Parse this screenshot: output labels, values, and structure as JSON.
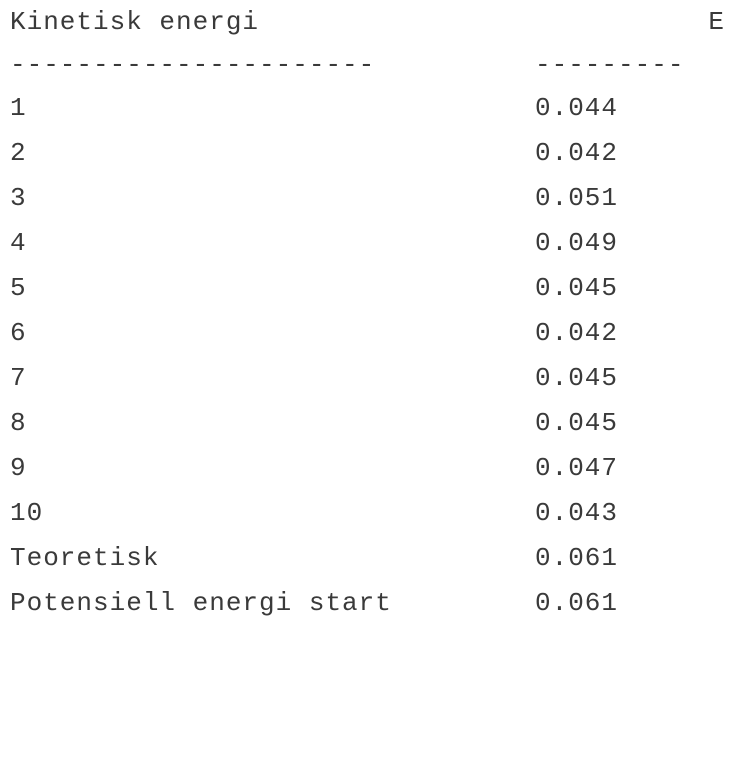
{
  "table": {
    "header": {
      "col1": "Kinetisk energi",
      "col2": "E"
    },
    "rule": {
      "col1": "----------------------",
      "col2": "---------"
    },
    "rows": [
      {
        "label": "1",
        "value": "0.044"
      },
      {
        "label": "2",
        "value": "0.042"
      },
      {
        "label": "3",
        "value": "0.051"
      },
      {
        "label": "4",
        "value": "0.049"
      },
      {
        "label": "5",
        "value": "0.045"
      },
      {
        "label": "6",
        "value": "0.042"
      },
      {
        "label": "7",
        "value": "0.045"
      },
      {
        "label": "8",
        "value": "0.045"
      },
      {
        "label": "9",
        "value": "0.047"
      },
      {
        "label": "10",
        "value": "0.043"
      },
      {
        "label": "Teoretisk",
        "value": "0.061"
      },
      {
        "label": "Potensiell energi start",
        "value": "0.061"
      }
    ]
  }
}
